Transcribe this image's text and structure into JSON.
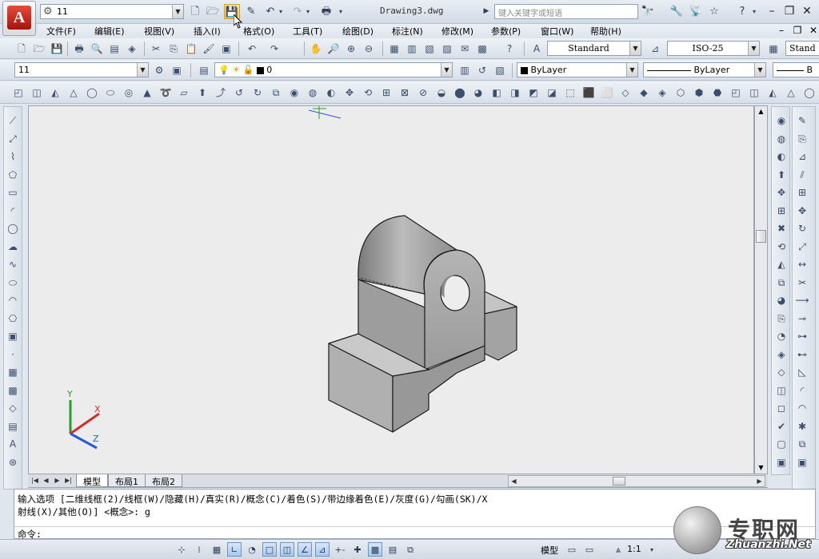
{
  "window": {
    "document_title": "Drawing3.dwg",
    "workspace_value": "11",
    "search_placeholder": "键入关键字或短语",
    "app_logo_letter": "A"
  },
  "menu": {
    "items": [
      "文件(F)",
      "编辑(E)",
      "视图(V)",
      "插入(I)",
      "格式(O)",
      "工具(T)",
      "绘图(D)",
      "标注(N)",
      "修改(M)",
      "参数(P)",
      "窗口(W)",
      "帮助(H)"
    ]
  },
  "styles_toolbar": {
    "text_style": "Standard",
    "dim_style": "ISO-25",
    "table_style_partial": "Stand"
  },
  "layers_toolbar": {
    "layer_state": "11",
    "current_layer": "0",
    "color": "ByLayer",
    "linetype": "ByLayer",
    "lineweight_partial": "B"
  },
  "layout_tabs": [
    "模型",
    "布局1",
    "布局2"
  ],
  "command_line": {
    "history_line1": "输入选项 [二维线框(2)/线框(W)/隐藏(H)/真实(R)/概念(C)/着色(S)/带边缘着色(E)/灰度(G)/勾画(SK)/X",
    "history_line2": "射线(X)/其他(O)] <概念>: g",
    "prompt": "命令:",
    "input_value": ""
  },
  "status_bar": {
    "space_label": "模型",
    "annotation_scale": "1:1"
  },
  "ucs": {
    "x_label": "X",
    "y_label": "Y",
    "z_label": "Z"
  },
  "watermark": {
    "text": "专职网",
    "url": "Zhuanzhi.Net"
  },
  "colors": {
    "canvas_bg": "#ececec",
    "model_fill": "#a8a8a8",
    "model_edge": "#1a1a1a",
    "axis_x": "#d12d2d",
    "axis_y": "#2c9b2c",
    "axis_z": "#2a5bd1"
  }
}
